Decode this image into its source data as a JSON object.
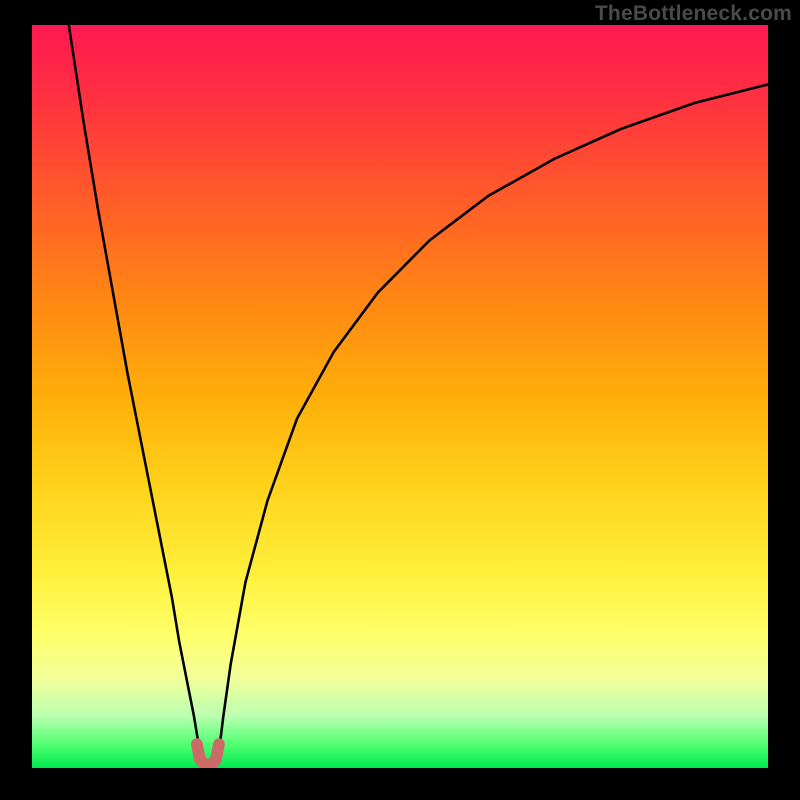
{
  "attribution": "TheBottleneck.com",
  "chart_data": {
    "type": "line",
    "title": "",
    "xlabel": "",
    "ylabel": "",
    "xlim": [
      0,
      100
    ],
    "ylim": [
      0,
      100
    ],
    "grid": false,
    "legend": false,
    "annotations": [],
    "series": [
      {
        "name": "left-curve",
        "x": [
          5,
          7,
          9,
          11,
          13,
          15,
          17,
          19,
          20,
          21,
          22,
          22.5,
          23,
          23.5
        ],
        "values": [
          100,
          87,
          75,
          64,
          53,
          43,
          33,
          23,
          17,
          12,
          7,
          4,
          2,
          0.5
        ]
      },
      {
        "name": "right-curve",
        "x": [
          25,
          25.5,
          26,
          27,
          29,
          32,
          36,
          41,
          47,
          54,
          62,
          71,
          80,
          90,
          100
        ],
        "values": [
          0.5,
          3,
          7,
          14,
          25,
          36,
          47,
          56,
          64,
          71,
          77,
          82,
          86,
          89.5,
          92
        ]
      },
      {
        "name": "trough-marker",
        "x": [
          22.4,
          22.8,
          23.5,
          24.3,
          25.0,
          25.4
        ],
        "values": [
          3.2,
          1.2,
          0.4,
          0.4,
          1.2,
          3.2
        ]
      }
    ],
    "colors": {
      "curves": "#000000",
      "trough": "#cc6a66"
    }
  }
}
